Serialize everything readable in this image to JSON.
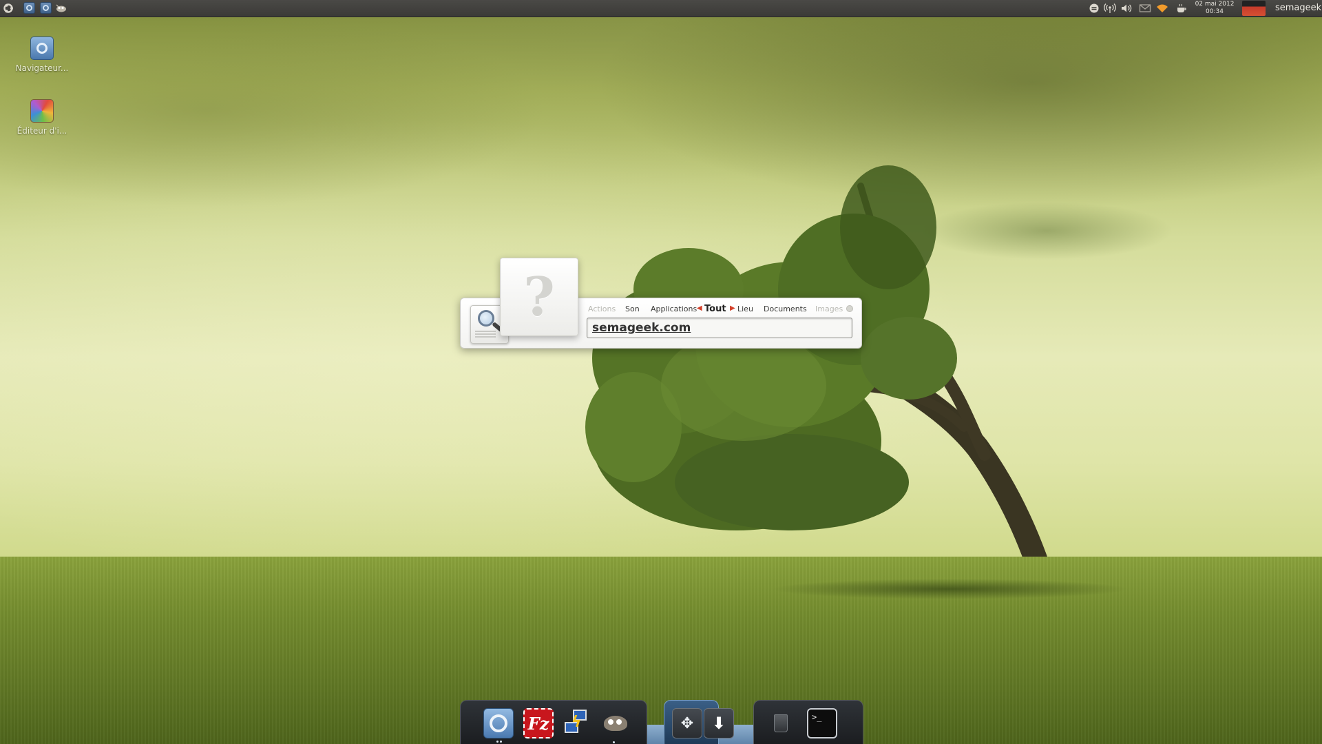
{
  "top_panel": {
    "left_icons": [
      "ubuntu-logo-icon",
      "browser-launcher-icon",
      "browser-launcher-icon",
      "gimp-launcher-icon"
    ],
    "tray_icons": [
      "sync-icon",
      "broadcast-icon",
      "volume-icon",
      "mail-icon",
      "wifi-icon",
      "coffee-icon"
    ],
    "clock": {
      "date": "02 mai 2012",
      "time": "00:34"
    },
    "user": "semageek"
  },
  "desktop_icons": [
    {
      "label": "Navigateur...",
      "icon": "browser-icon"
    },
    {
      "label": "Éditeur d'i...",
      "icon": "image-editor-icon"
    }
  ],
  "search": {
    "categories": [
      {
        "label": "Actions",
        "state": "faded"
      },
      {
        "label": "Son",
        "state": "normal"
      },
      {
        "label": "Applications",
        "state": "normal"
      },
      {
        "label": "Tout",
        "state": "active"
      },
      {
        "label": "Lieu",
        "state": "normal"
      },
      {
        "label": "Documents",
        "state": "normal"
      },
      {
        "label": "Images",
        "state": "faded"
      }
    ],
    "query": "semageek.com",
    "preview_symbol": "?"
  },
  "dock": {
    "items": [
      "browser-icon",
      "filezilla-icon",
      "network-icon",
      "gimp-icon",
      "move-icon",
      "download-icon",
      "trash-icon",
      "terminal-icon"
    ],
    "filezilla_glyph": "Fz",
    "terminal_glyph": ">_"
  },
  "colors": {
    "panel": "#3b3a37",
    "accent_red": "#d4402a",
    "dock": "#1b1d20"
  }
}
